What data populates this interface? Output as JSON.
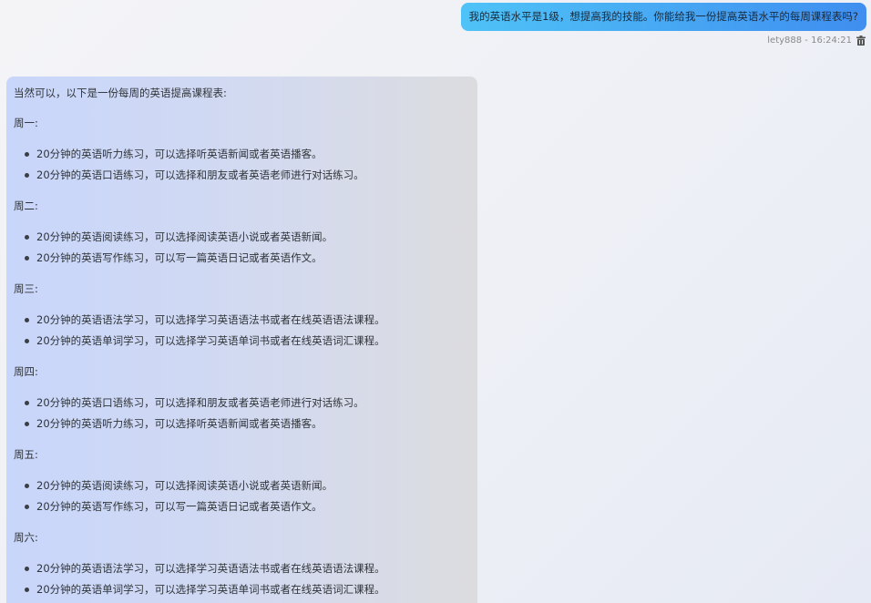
{
  "user_message": {
    "text": "我的英语水平是1级，想提高我的技能。你能给我一份提高英语水平的每周课程表吗?",
    "meta": "lety888 - 16:24:21",
    "delete_icon": "trash-icon"
  },
  "bot_message": {
    "intro": "当然可以，以下是一份每周的英语提高课程表:",
    "days": [
      {
        "label": "周一:",
        "items": [
          "20分钟的英语听力练习，可以选择听英语新闻或者英语播客。",
          "20分钟的英语口语练习，可以选择和朋友或者英语老师进行对话练习。"
        ]
      },
      {
        "label": "周二:",
        "items": [
          "20分钟的英语阅读练习，可以选择阅读英语小说或者英语新闻。",
          "20分钟的英语写作练习，可以写一篇英语日记或者英语作文。"
        ]
      },
      {
        "label": "周三:",
        "items": [
          "20分钟的英语语法学习，可以选择学习英语语法书或者在线英语语法课程。",
          "20分钟的英语单词学习，可以选择学习英语单词书或者在线英语词汇课程。"
        ]
      },
      {
        "label": "周四:",
        "items": [
          "20分钟的英语口语练习，可以选择和朋友或者英语老师进行对话练习。",
          "20分钟的英语听力练习，可以选择听英语新闻或者英语播客。"
        ]
      },
      {
        "label": "周五:",
        "items": [
          "20分钟的英语阅读练习，可以选择阅读英语小说或者英语新闻。",
          "20分钟的英语写作练习，可以写一篇英语日记或者英语作文。"
        ]
      },
      {
        "label": "周六:",
        "items": [
          "20分钟的英语语法学习，可以选择学习英语语法书或者在线英语语法课程。",
          "20分钟的英语单词学习，可以选择学习英语单词书或者在线英语词汇课程。"
        ]
      }
    ]
  }
}
